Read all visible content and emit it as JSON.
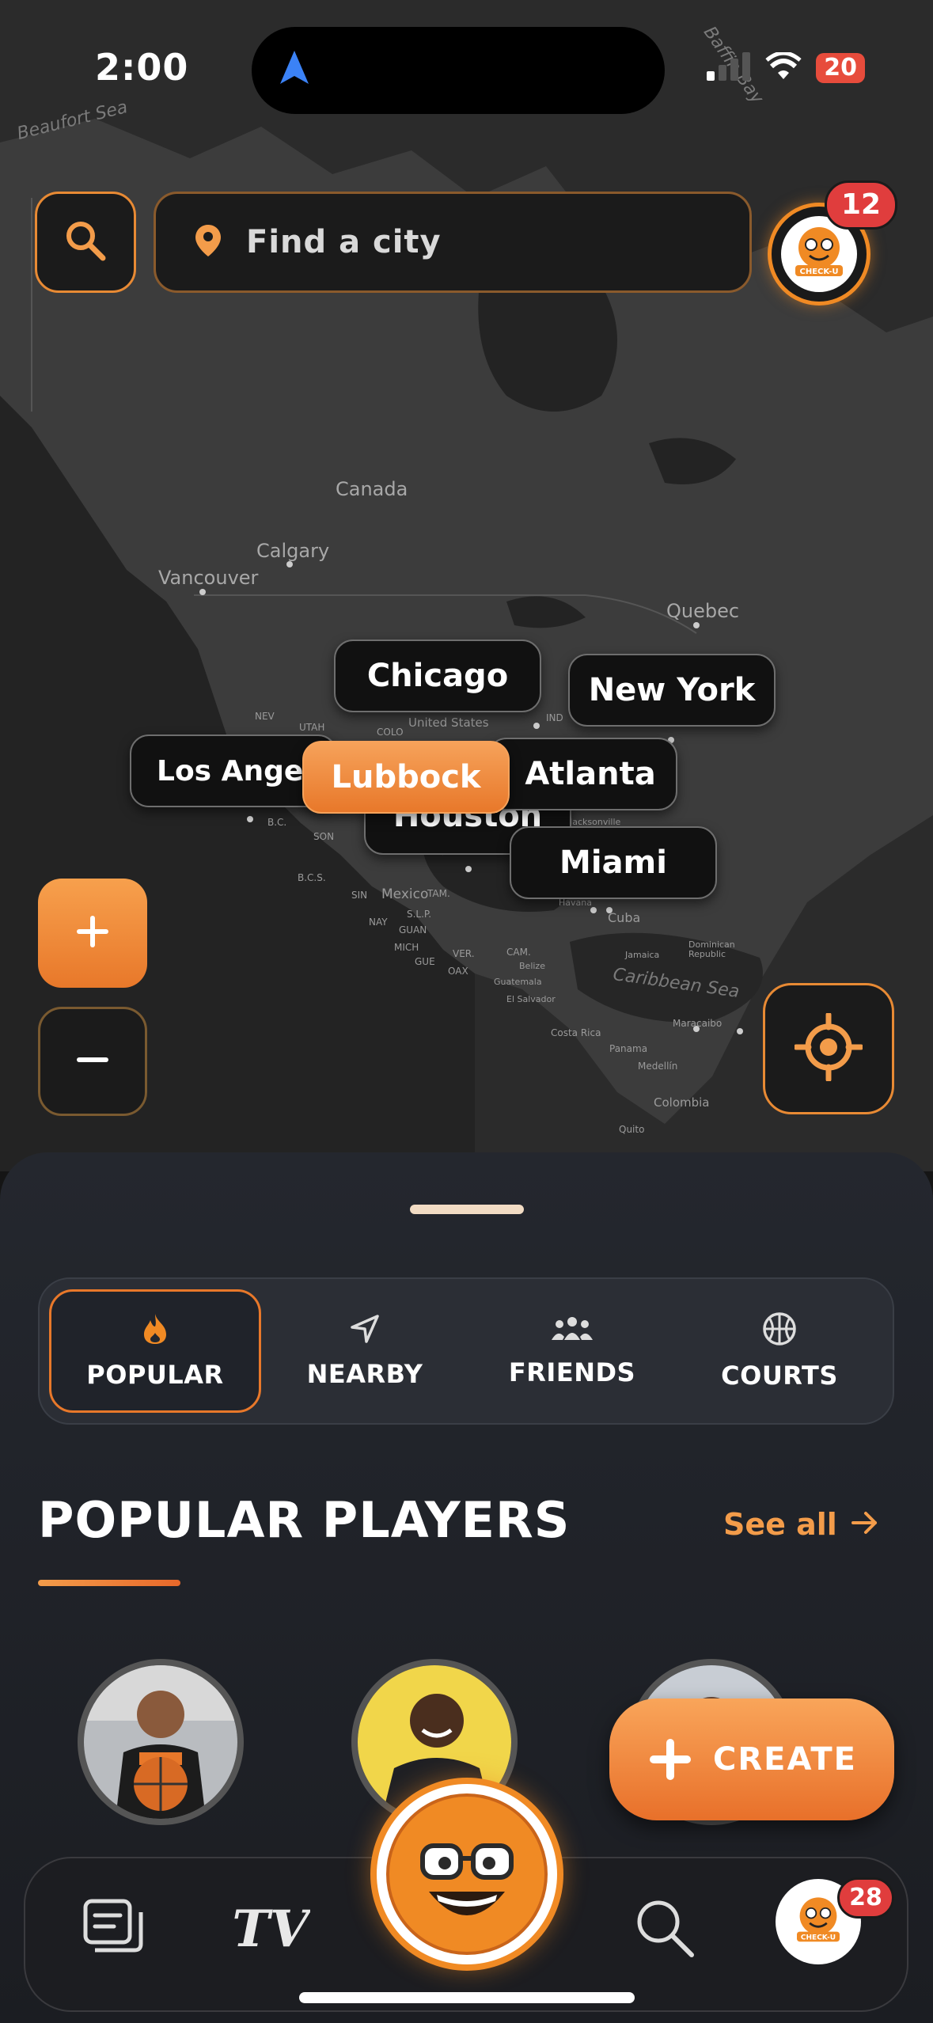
{
  "status": {
    "time": "2:00",
    "battery": "20"
  },
  "search": {
    "placeholder": "Find a city"
  },
  "profile": {
    "notifications": "12"
  },
  "map": {
    "labels": {
      "beaufort": "Beaufort Sea",
      "baffin": "Baffin Bay",
      "canada": "Canada",
      "calgary": "Calgary",
      "vancouver": "Vancouver",
      "quebec": "Quebec",
      "us": "United States",
      "mexico": "Mexico",
      "cuba": "Cuba",
      "caribbean": "Caribbean Sea",
      "colombia": "Colombia",
      "medellin": "Medellín",
      "panama": "Panama",
      "costarica": "Costa Rica",
      "guatemala": "Guatemala",
      "quito": "Quito",
      "jamaica": "Jamaica",
      "maracaibo": "Maracaibo",
      "nev": "NEV",
      "utah": "UTAH",
      "colo": "COLO",
      "ind": "IND",
      "son": "SON",
      "bc": "B.C.",
      "bcs": "B.C.S.",
      "sin": "SIN",
      "tam": "TAM.",
      "slp": "S.L.P.",
      "nay": "NAY",
      "guan": "GUAN",
      "mich": "MICH",
      "gue": "GUE",
      "oax": "OAX",
      "ver": "VER.",
      "cam": "CAM.",
      "belize": "Belize",
      "elsalvador": "El Salvador",
      "jacksonville": "Jacksonville",
      "havana": "Havana",
      "dominican": "Dominican Republic"
    },
    "cities": [
      "Chicago",
      "New York",
      "Los Angeles",
      "Lubbock",
      "Atlanta",
      "Houston",
      "Miami"
    ]
  },
  "tabs": [
    {
      "label": "POPULAR",
      "icon": "flame-icon",
      "active": true
    },
    {
      "label": "NEARBY",
      "icon": "navigation-arrow-icon",
      "active": false
    },
    {
      "label": "FRIENDS",
      "icon": "group-icon",
      "active": false
    },
    {
      "label": "COURTS",
      "icon": "basketball-icon",
      "active": false
    }
  ],
  "section": {
    "title": "POPULAR PLAYERS",
    "see_all": "See all"
  },
  "create": {
    "label": "CREATE"
  },
  "tabbar": {
    "profile_badge": "28"
  },
  "colors": {
    "accent": "#e8782a",
    "badge": "#e03d3d",
    "map_bg": "#2a2a2a"
  }
}
